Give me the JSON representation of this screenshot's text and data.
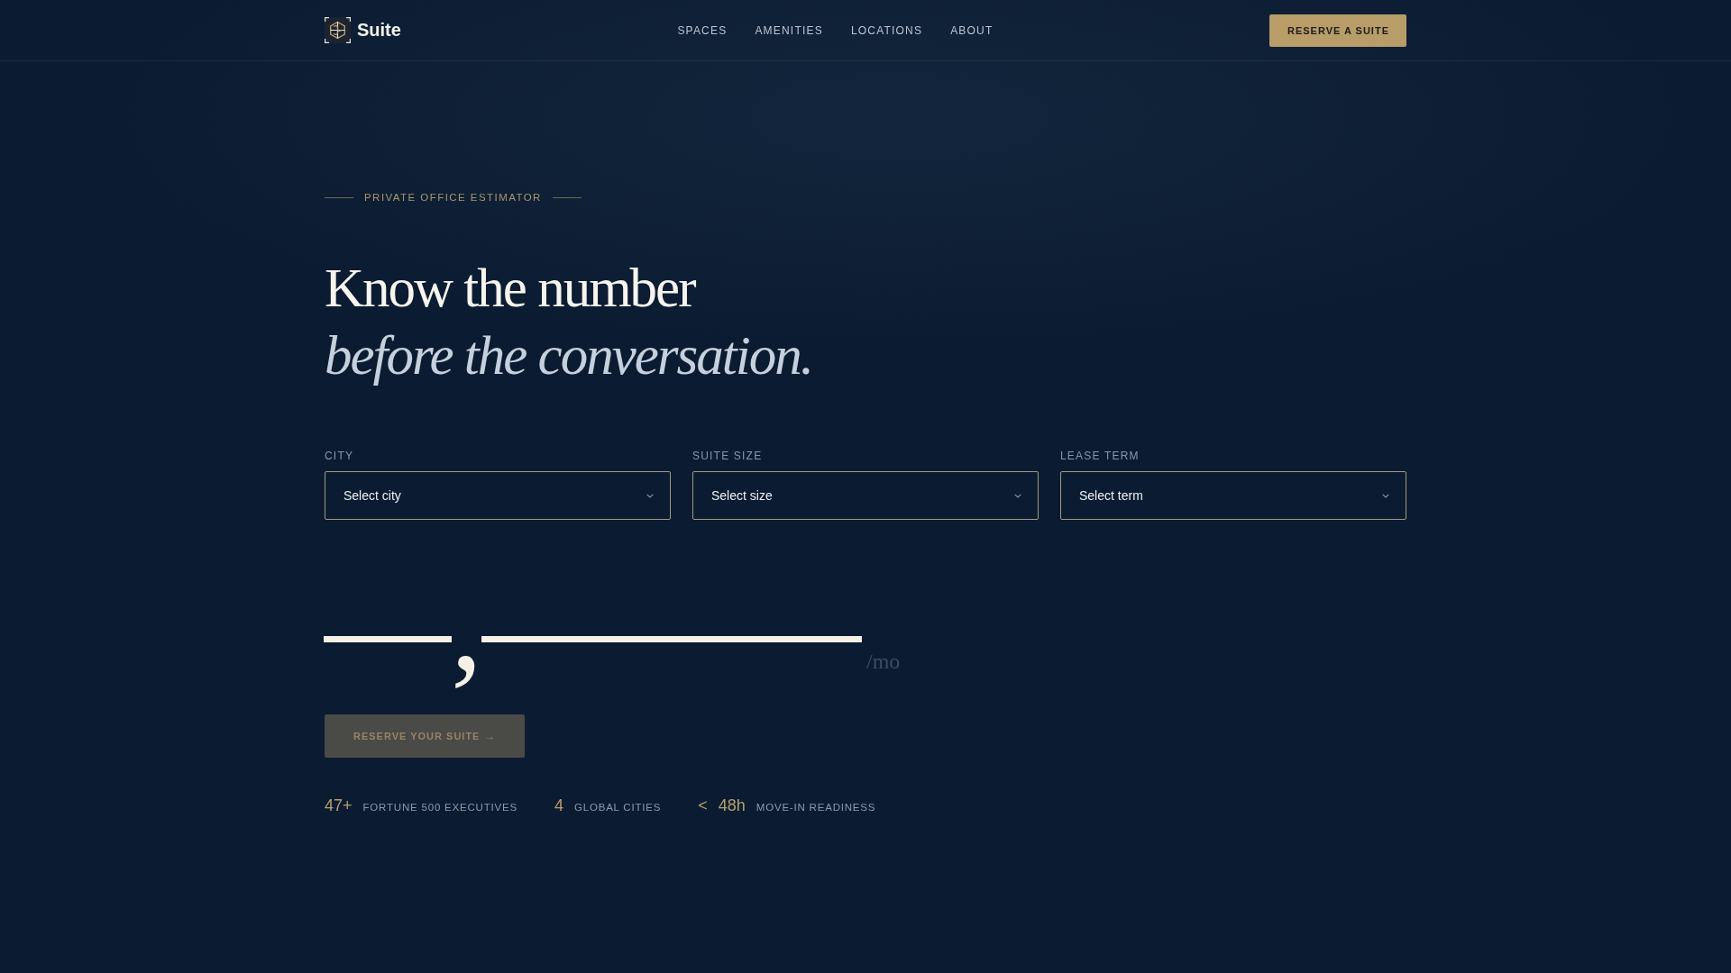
{
  "header": {
    "brand": "Suite",
    "nav": [
      "SPACES",
      "AMENITIES",
      "LOCATIONS",
      "ABOUT"
    ],
    "cta": "RESERVE A SUITE"
  },
  "hero": {
    "eyebrow": "PRIVATE OFFICE ESTIMATOR",
    "headline": "Know the number",
    "headline_accent": "before the conversation."
  },
  "estimator": {
    "fields": [
      {
        "label": "CITY",
        "placeholder": "Select city"
      },
      {
        "label": "SUITE SIZE",
        "placeholder": "Select size"
      },
      {
        "label": "LEASE TERM",
        "placeholder": "Select term"
      }
    ],
    "estimate": {
      "amount": "—,———",
      "unit": "/mo"
    },
    "submit": {
      "label": "RESERVE YOUR SUITE",
      "arrow": "→",
      "disabled": true
    }
  },
  "stats": [
    {
      "value": "47+",
      "label": "FORTUNE 500 EXECUTIVES"
    },
    {
      "value": "4",
      "label": "GLOBAL CITIES"
    },
    {
      "prefix": "<",
      "value": "48h",
      "label": "MOVE-IN READINESS"
    }
  ]
}
